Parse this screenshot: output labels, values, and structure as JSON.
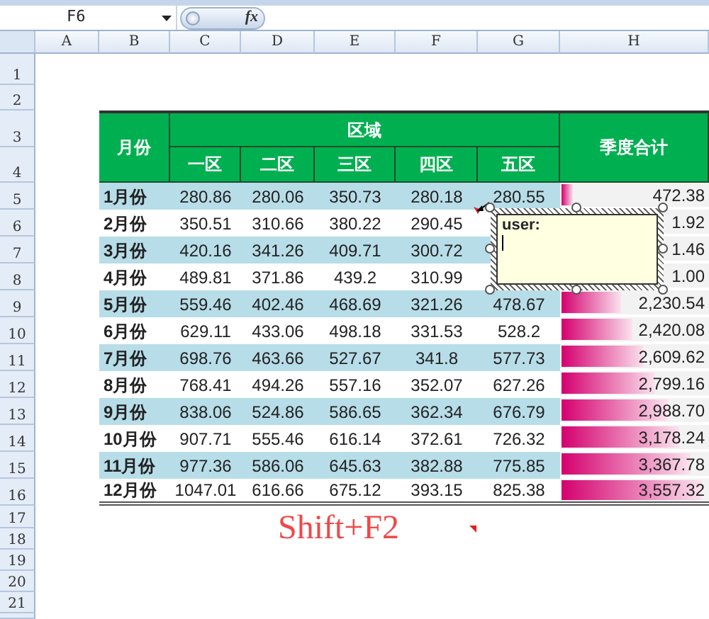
{
  "formula_bar": {
    "name_box": "F6",
    "function_button": "fx"
  },
  "columns": [
    "A",
    "B",
    "C",
    "D",
    "E",
    "F",
    "G",
    "H"
  ],
  "row_numbers": [
    "1",
    "2",
    "3",
    "4",
    "5",
    "6",
    "7",
    "8",
    "9",
    "10",
    "11",
    "12",
    "13",
    "14",
    "15",
    "16",
    "17",
    "18",
    "19",
    "20",
    "21"
  ],
  "table": {
    "month_header": "月份",
    "region_header": "区域",
    "zones": [
      "一区",
      "二区",
      "三区",
      "四区",
      "五区"
    ],
    "total_header": "季度合计",
    "rows": [
      {
        "month": "1月份",
        "values": [
          "280.86",
          "280.06",
          "350.73",
          "280.18",
          "280.55"
        ],
        "total": "472.38",
        "level": 0.08
      },
      {
        "month": "2月份",
        "values": [
          "350.51",
          "310.66",
          "380.22",
          "290.45"
        ],
        "total": "1.92"
      },
      {
        "month": "3月份",
        "values": [
          "420.16",
          "341.26",
          "409.71",
          "300.72"
        ],
        "total": "1.46"
      },
      {
        "month": "4月份",
        "values": [
          "489.81",
          "371.86",
          "439.2",
          "310.99"
        ],
        "total": "1.00"
      },
      {
        "month": "5月份",
        "values": [
          "559.46",
          "402.46",
          "468.69",
          "321.26",
          "478.67"
        ],
        "total": "2,230.54",
        "level": 0.4
      },
      {
        "month": "6月份",
        "values": [
          "629.11",
          "433.06",
          "498.18",
          "331.53",
          "528.2"
        ],
        "total": "2,420.08",
        "level": 0.48
      },
      {
        "month": "7月份",
        "values": [
          "698.76",
          "463.66",
          "527.67",
          "341.8",
          "577.73"
        ],
        "total": "2,609.62",
        "level": 0.55
      },
      {
        "month": "8月份",
        "values": [
          "768.41",
          "494.26",
          "557.16",
          "352.07",
          "627.26"
        ],
        "total": "2,799.16",
        "level": 0.63
      },
      {
        "month": "9月份",
        "values": [
          "838.06",
          "524.86",
          "586.65",
          "362.34",
          "676.79"
        ],
        "total": "2,988.70",
        "level": 0.71
      },
      {
        "month": "10月份",
        "values": [
          "907.71",
          "555.46",
          "616.14",
          "372.61",
          "726.32"
        ],
        "total": "3,178.24",
        "level": 0.79
      },
      {
        "month": "11月份",
        "values": [
          "977.36",
          "586.06",
          "645.63",
          "382.88",
          "775.85"
        ],
        "total": "3,367.78",
        "level": 0.87
      },
      {
        "month": "12月份",
        "values": [
          "1047.01",
          "616.66",
          "675.12",
          "393.15",
          "825.38"
        ],
        "total": "3,557.32",
        "level": 0.94
      }
    ]
  },
  "comment": {
    "author": "user:"
  },
  "annotation": "Shift+F2"
}
